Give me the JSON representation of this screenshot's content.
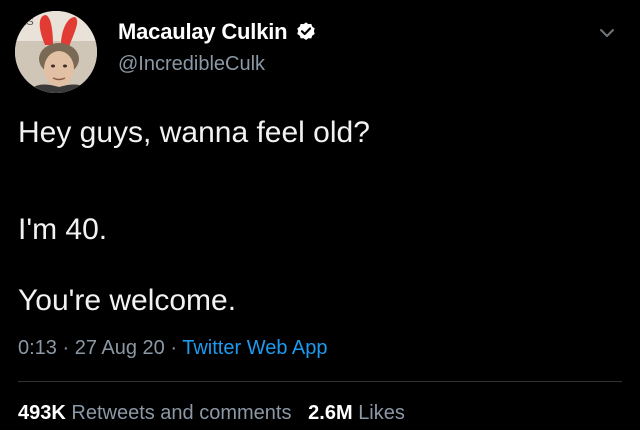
{
  "author": {
    "display_name": "Macaulay Culkin",
    "handle": "@IncredibleCulk",
    "verified": true,
    "avatar_icon": "profile-photo-with-bunny-ears"
  },
  "tweet": {
    "lines": [
      "Hey guys, wanna feel old?",
      "I'm 40.",
      "You're welcome."
    ],
    "time": "0:13",
    "sep1": " · ",
    "date": "27 Aug 20",
    "sep2": " · ",
    "source": "Twitter Web App"
  },
  "stats": {
    "retweets_count": "493K",
    "retweets_label": "Retweets and comments",
    "likes_count": "2.6M",
    "likes_label": "Likes"
  },
  "icons": {
    "verified": "verified-badge-icon",
    "menu": "chevron-down-icon"
  },
  "colors": {
    "background": "#000000",
    "text_primary": "#ffffff",
    "text_secondary": "#8b98a5",
    "link": "#1d9bf0",
    "divider": "#2f3336"
  }
}
